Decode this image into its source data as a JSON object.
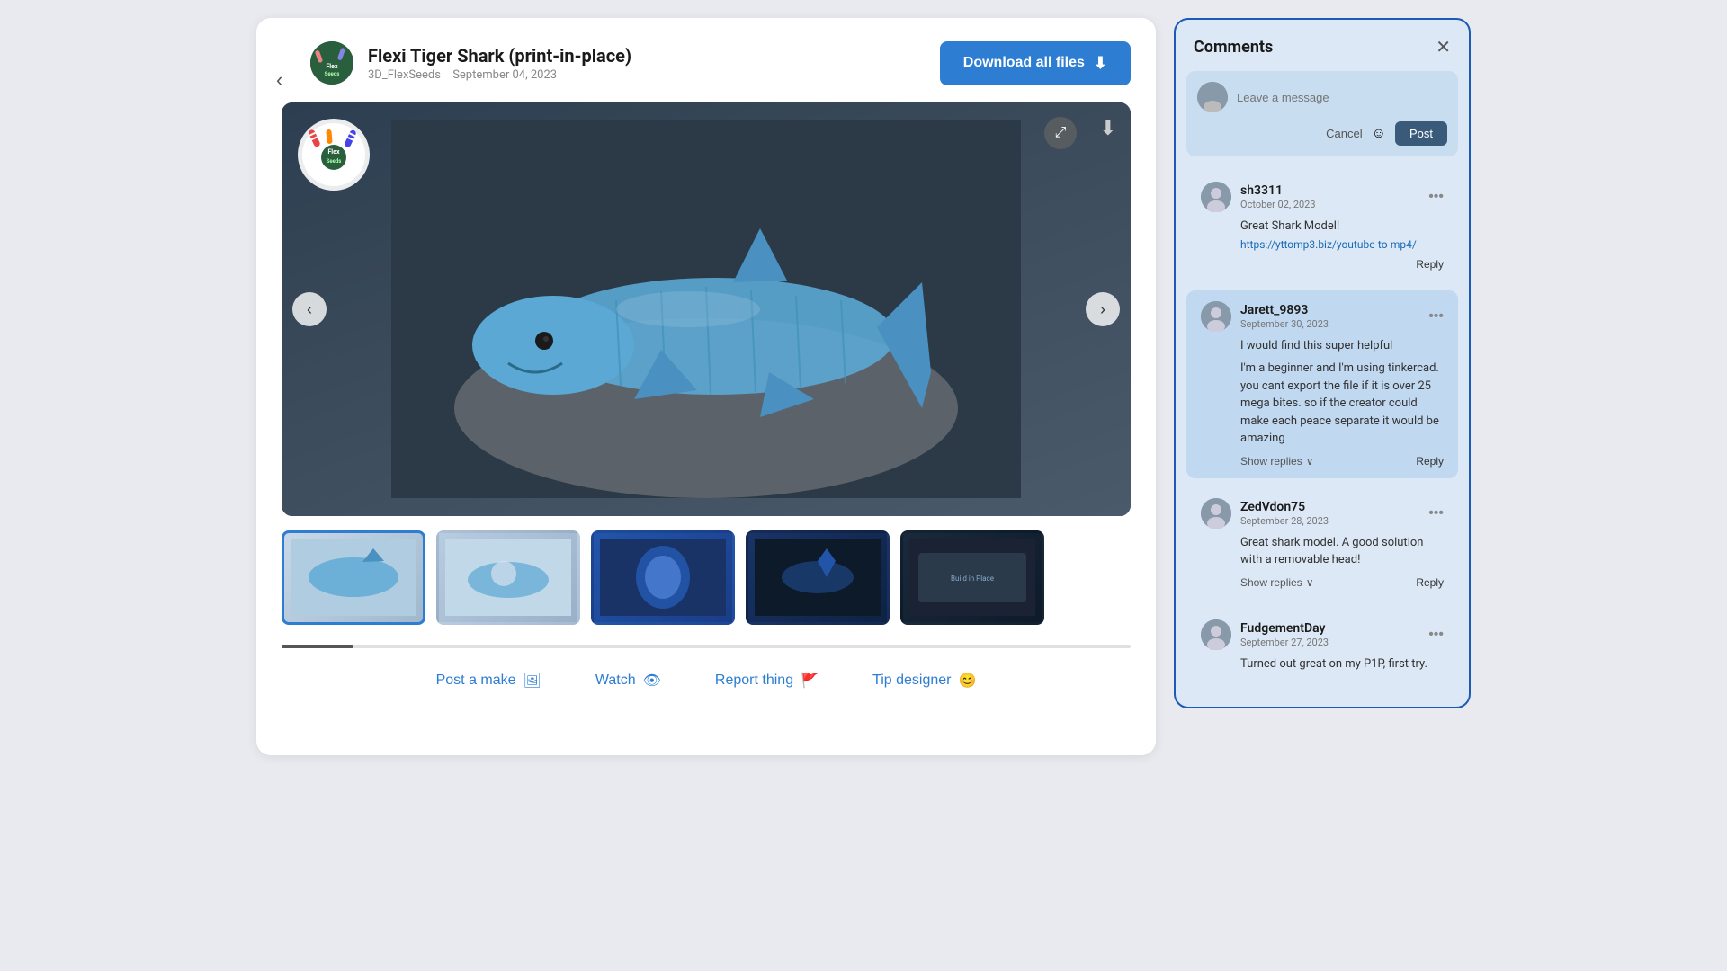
{
  "page": {
    "background": "#e8eaf0"
  },
  "header": {
    "title": "Flexi Tiger Shark (print-in-place)",
    "author": "3D_FlexSeeds",
    "date": "September 04, 2023",
    "download_btn": "Download all files"
  },
  "actions": {
    "post_make": "Post a make",
    "watch": "Watch",
    "report": "Report thing",
    "tip": "Tip designer"
  },
  "comments": {
    "title": "Comments",
    "input_placeholder": "Leave a message",
    "cancel_label": "Cancel",
    "post_label": "Post",
    "items": [
      {
        "username": "sh3311",
        "date": "October 02, 2023",
        "text": "Great Shark Model!",
        "link": "https://yttomp3.biz/youtube-to-mp4/",
        "has_link": true,
        "show_replies": false,
        "reply_label": "Reply"
      },
      {
        "username": "Jarett_9893",
        "date": "September 30, 2023",
        "text": "I would find this super helpful",
        "subtext": "I'm a beginner and I'm using tinkercad. you cant export the file if it is over 25 mega bites. so if the creator could make each peace separate it would be amazing",
        "has_link": false,
        "show_replies": true,
        "show_replies_label": "Show replies",
        "reply_label": "Reply"
      },
      {
        "username": "ZedVdon75",
        "date": "September 28, 2023",
        "text": "Great shark model. A good solution with a removable head!",
        "has_link": false,
        "show_replies": true,
        "show_replies_label": "Show replies",
        "reply_label": "Reply"
      },
      {
        "username": "FudgementDay",
        "date": "September 27, 2023",
        "text": "Turned out great on my P1P, first try.",
        "has_link": false,
        "show_replies": false,
        "reply_label": "Reply"
      }
    ]
  },
  "thumbnails": [
    {
      "id": 1,
      "active": true
    },
    {
      "id": 2,
      "active": false
    },
    {
      "id": 3,
      "active": false
    },
    {
      "id": 4,
      "active": false
    },
    {
      "id": 5,
      "active": false
    }
  ]
}
